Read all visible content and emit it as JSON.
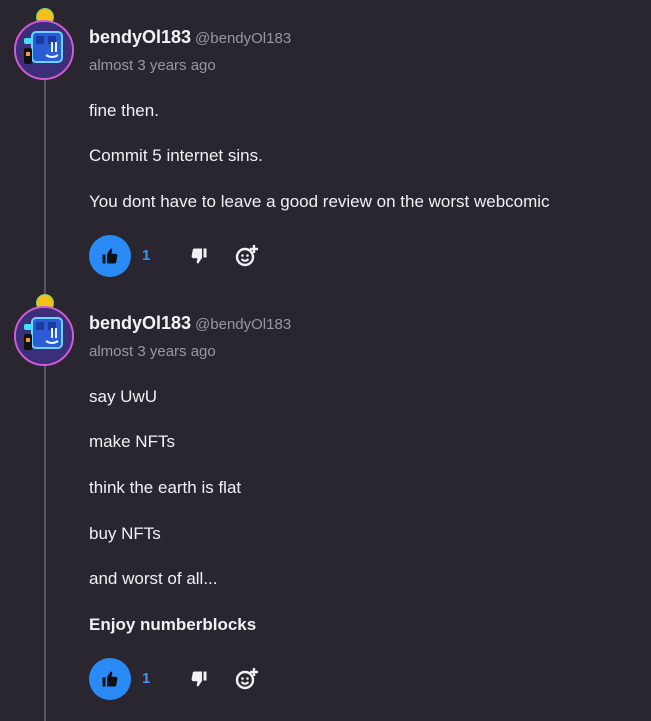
{
  "comments": [
    {
      "author": "bendyOl183",
      "handle": "@bendyOl183",
      "time": "almost 3 years ago",
      "lines": [
        "fine then.",
        "Commit 5 internet sins.",
        "You dont have to leave a good review on the worst webcomic"
      ],
      "likes": "1"
    },
    {
      "author": "bendyOl183",
      "handle": "@bendyOl183",
      "time": "almost 3 years ago",
      "lines": [
        "say UwU",
        "make NFTs",
        "think the earth is flat",
        "buy NFTs",
        "and worst of all...",
        "Enjoy numberblocks"
      ],
      "likes": "1"
    }
  ],
  "icons": {
    "like": "thumbs-up-icon",
    "dislike": "thumbs-down-icon",
    "react": "add-reaction-icon"
  },
  "colors": {
    "background": "#2a2630",
    "accent": "#2a8bf6",
    "muted_text": "#9a96a3",
    "avatar_ring": "#d25bd6"
  }
}
